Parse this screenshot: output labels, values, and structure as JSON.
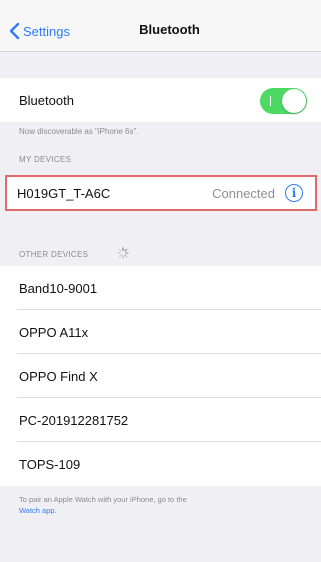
{
  "nav": {
    "back_label": "Settings",
    "title": "Bluetooth"
  },
  "bluetooth": {
    "label": "Bluetooth",
    "enabled": true,
    "discoverable_text": "Now discoverable as \"iPhone 6s\"."
  },
  "my_devices": {
    "header": "MY DEVICES",
    "items": [
      {
        "name": "H019GT_T-A6C",
        "status": "Connected"
      }
    ]
  },
  "other_devices": {
    "header": "OTHER DEVICES",
    "items": [
      {
        "name": "Band10-9001"
      },
      {
        "name": "OPPO A11x"
      },
      {
        "name": "OPPO Find X"
      },
      {
        "name": "PC-201912281752"
      },
      {
        "name": "TOPS-109"
      }
    ]
  },
  "footer": {
    "text": "To pair an Apple Watch with your iPhone, go to the",
    "link": "Watch app."
  },
  "colors": {
    "accent": "#2f7cf6",
    "toggle_on": "#4cd964",
    "highlight_border": "#e06a6a"
  }
}
